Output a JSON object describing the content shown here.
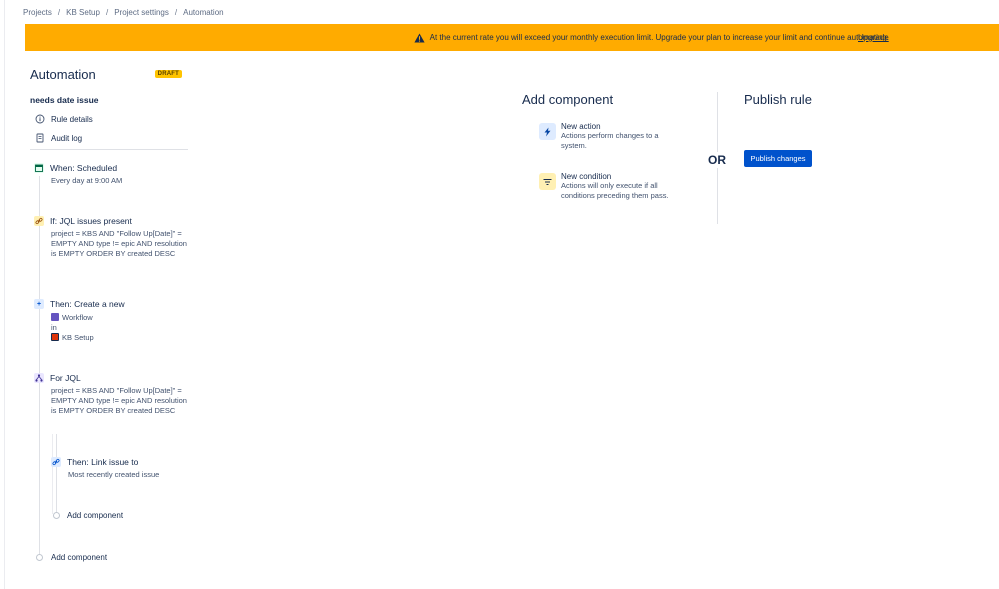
{
  "breadcrumbs": [
    "Projects",
    "KB Setup",
    "Project settings",
    "Automation"
  ],
  "banner": {
    "message": "At the current rate you will exceed your monthly execution limit. Upgrade your plan to increase your limit and continue automating.",
    "link": "Upgrade",
    "color": "#ffab00"
  },
  "sidebar": {
    "title": "Automation",
    "status": "DRAFT",
    "rule_name": "needs date issue",
    "links": [
      {
        "label": "Rule details",
        "icon": "info-icon"
      },
      {
        "label": "Audit log",
        "icon": "document-icon"
      }
    ]
  },
  "flow": {
    "trigger": {
      "label": "When: Scheduled",
      "desc": "Every day at 9:00 AM",
      "icon": "calendar-icon"
    },
    "condition": {
      "label": "If: JQL issues present",
      "desc": "project = KBS AND \"Follow Up[Date]\" = EMPTY AND type != epic AND resolution is EMPTY ORDER BY created DESC",
      "icon": "link-icon"
    },
    "action": {
      "label": "Then: Create a new",
      "item1": "Workflow",
      "connector": "in",
      "item2": "KB Setup",
      "icon": "plus-icon"
    },
    "branch": {
      "label": "For JQL",
      "desc": "project = KBS AND \"Follow Up[Date]\" = EMPTY AND type != epic AND resolution is EMPTY ORDER BY created DESC",
      "icon": "branch-icon"
    },
    "branch_action": {
      "label": "Then: Link issue to",
      "desc": "Most recently created issue",
      "icon": "link-icon"
    },
    "branch_add": "Add component",
    "root_add": "Add component"
  },
  "add_component": {
    "title": "Add component",
    "items": [
      {
        "title": "New action",
        "desc": "Actions perform changes to a system.",
        "icon": "lightning-icon"
      },
      {
        "title": "New condition",
        "desc": "Actions will only execute if all conditions preceding them pass.",
        "icon": "filter-icon"
      }
    ]
  },
  "or_label": "OR",
  "publish": {
    "title": "Publish rule",
    "button": "Publish changes",
    "color": "#0052cc"
  }
}
